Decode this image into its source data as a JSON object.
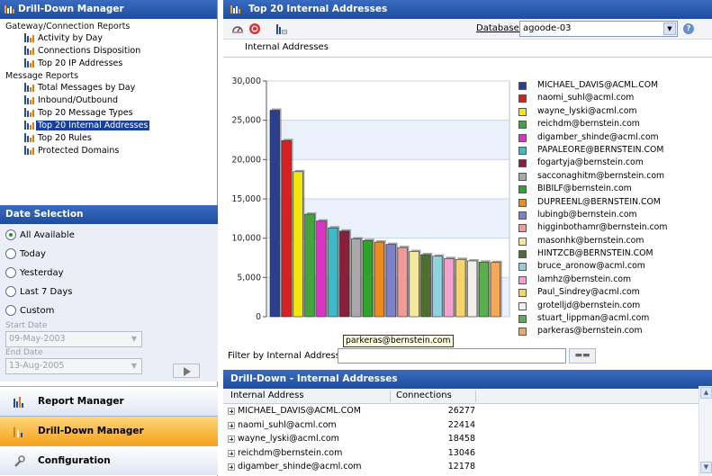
{
  "left": {
    "title": "Drill-Down Manager",
    "tree": [
      {
        "kind": "group",
        "label": "Gateway/Connection Reports"
      },
      {
        "kind": "item",
        "label": "Activity by Day"
      },
      {
        "kind": "item",
        "label": "Connections Disposition"
      },
      {
        "kind": "item",
        "label": "Top 20 IP Addresses"
      },
      {
        "kind": "group",
        "label": "Message Reports"
      },
      {
        "kind": "item",
        "label": "Total Messages by Day"
      },
      {
        "kind": "item",
        "label": "Inbound/Outbound"
      },
      {
        "kind": "item",
        "label": "Top 20 Message Types"
      },
      {
        "kind": "item",
        "label": "Top 20 Internal Addresses",
        "selected": true
      },
      {
        "kind": "item",
        "label": "Top 20 Rules"
      },
      {
        "kind": "item",
        "label": "Protected Domains"
      }
    ],
    "date_selection": {
      "title": "Date Selection",
      "options": [
        "All Available",
        "Today",
        "Yesterday",
        "Last 7 Days",
        "Custom"
      ],
      "selected": "All Available",
      "start_label": "Start Date",
      "start_value": "09-May-2003",
      "end_label": "End Date",
      "end_value": "13-Aug-2005"
    },
    "nav": [
      {
        "label": "Report Manager",
        "icon": "bar-chart-icon",
        "active": false
      },
      {
        "label": "Drill-Down Manager",
        "icon": "drill-chart-icon",
        "active": true
      },
      {
        "label": "Configuration",
        "icon": "wrench-icon",
        "active": false
      }
    ]
  },
  "main": {
    "title": "Top 20 Internal Addresses",
    "database_label": "Database:",
    "database_value": "agoode-03",
    "tab": "Internal Addresses",
    "filter_label": "Filter by Internal Address:",
    "filter_value": "",
    "tooltip": "parkeras@bernstein.com",
    "drilldown_title": "Drill-Down - Internal Addresses",
    "grid_headers": [
      "Internal Address",
      "Connections"
    ],
    "grid_rows": [
      {
        "address": "MICHAEL_DAVIS@ACML.COM",
        "connections": "26277"
      },
      {
        "address": "naomi_suhl@acml.com",
        "connections": "22414"
      },
      {
        "address": "wayne_lyski@acml.com",
        "connections": "18458"
      },
      {
        "address": "reichdm@bernstein.com",
        "connections": "13046"
      },
      {
        "address": "digamber_shinde@acml.com",
        "connections": "12178"
      }
    ]
  },
  "chart_data": {
    "type": "bar",
    "ylim": [
      0,
      30000
    ],
    "yticks": [
      "0",
      "5,000",
      "10,000",
      "15,000",
      "20,000",
      "25,000",
      "30,000"
    ],
    "grid": true,
    "legend": "right",
    "categories": [
      "MICHAEL_DAVIS@ACML.COM",
      "naomi_suhl@acml.com",
      "wayne_lyski@acml.com",
      "reichdm@bernstein.com",
      "digamber_shinde@acml.com",
      "PAPALEORE@BERNSTEIN.COM",
      "fogartyja@bernstein.com",
      "sacconaghitm@bernstein.com",
      "BIBILF@bernstein.com",
      "DUPREENL@BERNSTEIN.COM",
      "lubingb@bernstein.com",
      "higginbothamr@bernstein.com",
      "masonhk@bernstein.com",
      "HINTZCB@BERNSTEIN.COM",
      "bruce_aronow@acml.com",
      "lamhz@bernstein.com",
      "Paul_Sindrey@acml.com",
      "grotelljd@bernstein.com",
      "stuart_lippman@acml.com",
      "parkeras@bernstein.com"
    ],
    "values": [
      26277,
      22414,
      18458,
      13046,
      12178,
      11300,
      10900,
      9900,
      9700,
      9500,
      9200,
      8800,
      8300,
      7900,
      7700,
      7400,
      7300,
      7100,
      6950,
      6900
    ],
    "colors": [
      "#2b3f8f",
      "#d91f1f",
      "#f2e60f",
      "#40a53c",
      "#d933c7",
      "#3fb8c8",
      "#8a1f3c",
      "#a9a9a9",
      "#2ea32e",
      "#f08a1c",
      "#7d82c8",
      "#f09a9a",
      "#f3e89c",
      "#4f6e2f",
      "#8fd3e0",
      "#f2a2cc",
      "#f6d36b",
      "#f0efea",
      "#57b04a",
      "#f6a85a"
    ]
  }
}
